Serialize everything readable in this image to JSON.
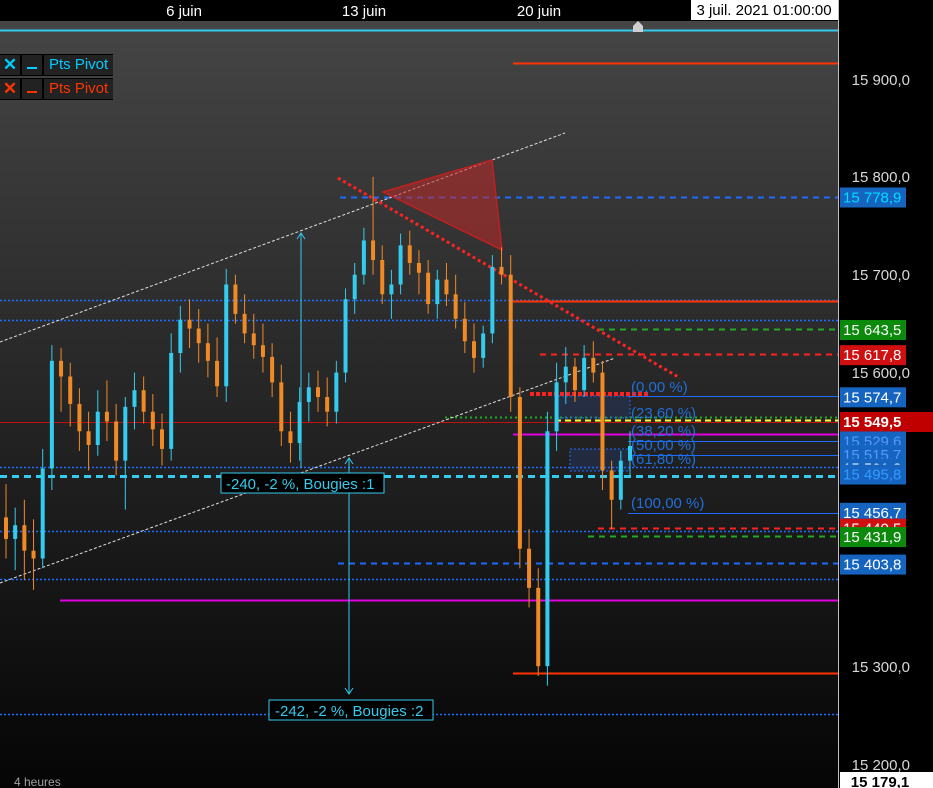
{
  "header": {
    "date_labels": [
      "6 juin",
      "13 juin",
      "20 juin"
    ],
    "cursor_date": "3 juil. 2021 01:00:00"
  },
  "footer": {
    "timeframe": "4 heures"
  },
  "legend": [
    {
      "label": "Pts Pivot",
      "color": "#00ccff"
    },
    {
      "label": "Pts Pivot",
      "color": "#ff3300"
    }
  ],
  "price_axis": {
    "ticks": [
      "15 900,0",
      "15 800,0",
      "15 700,0",
      "15 600,0",
      "15 300,0",
      "15 200,0"
    ],
    "bottom_label": "15 179,1"
  },
  "price_tags": [
    {
      "text": "15 778,9",
      "bg": "#1565c0",
      "fg": "#00ddff",
      "price": 15778.9
    },
    {
      "text": "15 643,5",
      "bg": "#0b8a0b",
      "fg": "#ffffff",
      "price": 15643.5
    },
    {
      "text": "15 617,8",
      "bg": "#d01010",
      "fg": "#ffffff",
      "price": 15617.8
    },
    {
      "text": "15 574,7",
      "bg": "#1565c0",
      "fg": "#ffffff",
      "price": 15574.7
    },
    {
      "text": "15 549,5",
      "bg": "#c00000",
      "fg": "#ffffff",
      "price": 15549.5,
      "bold": true
    },
    {
      "text": "15 529,6",
      "bg": "#1565c0",
      "fg": "#5599ff",
      "price": 15529.6
    },
    {
      "text": "15 515,7",
      "bg": "#1565c0",
      "fg": "#5599ff",
      "price": 15515.7
    },
    {
      "text": "15 501,8",
      "bg": "#1565c0",
      "fg": "#ffffff",
      "price": 15501.8
    },
    {
      "text": "15 495,8",
      "bg": "#1565c0",
      "fg": "#3399ff",
      "price": 15495.8
    },
    {
      "text": "15 456,7",
      "bg": "#1565c0",
      "fg": "#ffffff",
      "price": 15456.7
    },
    {
      "text": "15 440,5",
      "bg": "#d01010",
      "fg": "#ffffff",
      "price": 15440.5
    },
    {
      "text": "15 431,9",
      "bg": "#0b8a0b",
      "fg": "#ffffff",
      "price": 15431.9
    },
    {
      "text": "15 403,8",
      "bg": "#1565c0",
      "fg": "#ffffff",
      "price": 15403.8
    }
  ],
  "fibonacci_labels": [
    "(0,00 %)",
    "(23,60 %)",
    "(38,20 %)",
    "(50,00 %)",
    "(61,80 %)",
    "(100,00 %)"
  ],
  "measurements": [
    "-240, -2 %, Bougies :1",
    "-242, -2 %, Bougies :2"
  ],
  "colors": {
    "bull": "#33ccee",
    "bear": "#f08a24",
    "pivot_blue": "#1e6bff",
    "pivot_red": "#ff3300",
    "magenta": "#e000e0",
    "green": "#22aa22",
    "triangle": "#b22222"
  },
  "chart_data": {
    "type": "candlestick",
    "instrument_timeframe": "4 heures",
    "x_tick_labels": [
      "6 juin",
      "13 juin",
      "20 juin"
    ],
    "y_ticks": [
      15900,
      15800,
      15700,
      15600,
      15300,
      15200
    ],
    "ylim": [
      15179.1,
      15953
    ],
    "last_price": 15549.5,
    "horizontal_levels": [
      15778.9,
      15643.5,
      15617.8,
      15574.7,
      15549.5,
      15529.6,
      15515.7,
      15501.8,
      15495.8,
      15456.7,
      15440.5,
      15431.9,
      15403.8
    ],
    "candles": [
      [
        15452,
        15486,
        15410,
        15430
      ],
      [
        15430,
        15462,
        15398,
        15444
      ],
      [
        15444,
        15470,
        15388,
        15418
      ],
      [
        15418,
        15450,
        15378,
        15410
      ],
      [
        15410,
        15522,
        15400,
        15502
      ],
      [
        15502,
        15628,
        15480,
        15612
      ],
      [
        15612,
        15625,
        15560,
        15596
      ],
      [
        15596,
        15610,
        15545,
        15568
      ],
      [
        15568,
        15584,
        15520,
        15540
      ],
      [
        15540,
        15560,
        15500,
        15526
      ],
      [
        15526,
        15582,
        15515,
        15560
      ],
      [
        15560,
        15592,
        15530,
        15550
      ],
      [
        15550,
        15568,
        15495,
        15510
      ],
      [
        15510,
        15575,
        15460,
        15565
      ],
      [
        15565,
        15600,
        15542,
        15582
      ],
      [
        15582,
        15596,
        15548,
        15560
      ],
      [
        15560,
        15578,
        15525,
        15542
      ],
      [
        15542,
        15558,
        15505,
        15522
      ],
      [
        15522,
        15640,
        15510,
        15620
      ],
      [
        15620,
        15668,
        15600,
        15654
      ],
      [
        15654,
        15675,
        15625,
        15645
      ],
      [
        15645,
        15665,
        15610,
        15630
      ],
      [
        15630,
        15650,
        15595,
        15612
      ],
      [
        15612,
        15636,
        15575,
        15586
      ],
      [
        15586,
        15706,
        15570,
        15690
      ],
      [
        15690,
        15700,
        15650,
        15660
      ],
      [
        15660,
        15680,
        15630,
        15640
      ],
      [
        15640,
        15660,
        15614,
        15628
      ],
      [
        15628,
        15650,
        15600,
        15616
      ],
      [
        15616,
        15630,
        15575,
        15590
      ],
      [
        15590,
        15608,
        15525,
        15540
      ],
      [
        15540,
        15560,
        15508,
        15528
      ],
      [
        15528,
        15585,
        15510,
        15570
      ],
      [
        15570,
        15600,
        15550,
        15585
      ],
      [
        15585,
        15602,
        15560,
        15575
      ],
      [
        15575,
        15595,
        15545,
        15560
      ],
      [
        15560,
        15612,
        15548,
        15600
      ],
      [
        15600,
        15686,
        15590,
        15675
      ],
      [
        15675,
        15712,
        15660,
        15700
      ],
      [
        15700,
        15748,
        15690,
        15735
      ],
      [
        15735,
        15800,
        15700,
        15715
      ],
      [
        15715,
        15730,
        15670,
        15680
      ],
      [
        15680,
        15705,
        15655,
        15690
      ],
      [
        15690,
        15742,
        15680,
        15730
      ],
      [
        15730,
        15745,
        15700,
        15712
      ],
      [
        15712,
        15725,
        15680,
        15702
      ],
      [
        15702,
        15715,
        15660,
        15670
      ],
      [
        15670,
        15705,
        15655,
        15695
      ],
      [
        15695,
        15712,
        15668,
        15680
      ],
      [
        15680,
        15700,
        15645,
        15655
      ],
      [
        15655,
        15672,
        15620,
        15632
      ],
      [
        15632,
        15650,
        15600,
        15615
      ],
      [
        15615,
        15648,
        15605,
        15640
      ],
      [
        15640,
        15720,
        15630,
        15708
      ],
      [
        15708,
        15728,
        15690,
        15700
      ],
      [
        15700,
        15720,
        15560,
        15575
      ],
      [
        15575,
        15585,
        15400,
        15420
      ],
      [
        15420,
        15440,
        15360,
        15380
      ],
      [
        15380,
        15400,
        15290,
        15300
      ],
      [
        15300,
        15560,
        15280,
        15540
      ],
      [
        15540,
        15610,
        15520,
        15590
      ],
      [
        15590,
        15626,
        15568,
        15606
      ],
      [
        15606,
        15615,
        15570,
        15582
      ],
      [
        15582,
        15628,
        15575,
        15615
      ],
      [
        15615,
        15632,
        15590,
        15600
      ],
      [
        15600,
        15612,
        15480,
        15500
      ],
      [
        15500,
        15510,
        15440,
        15470
      ],
      [
        15470,
        15520,
        15460,
        15510
      ],
      [
        15510,
        15540,
        15495,
        15525
      ]
    ]
  }
}
